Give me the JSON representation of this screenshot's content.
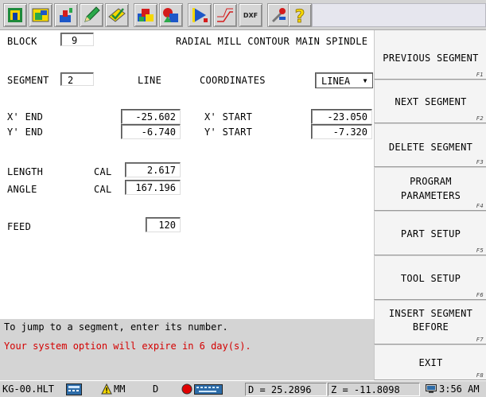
{
  "toolbar": {
    "icons": [
      "home-icon",
      "load-icon",
      "insert-part-icon",
      "pencil-icon",
      "edit-check-icon",
      "solids-icon",
      "shapes-icon",
      "run-icon",
      "path-icon",
      "dxf-icon",
      "tools-icon",
      "help-icon"
    ],
    "dxf_label": "DXF"
  },
  "form": {
    "block_label": "BLOCK",
    "block_value": "9",
    "operation": "RADIAL MILL CONTOUR",
    "spindle": "MAIN SPINDLE",
    "segment_label": "SEGMENT",
    "segment_value": "2",
    "segment_type": "LINE",
    "coordinates_label": "COORDINATES",
    "coordinates_value": "LINEA",
    "x_end_label": "X' END",
    "x_end_value": "-25.602",
    "y_end_label": "Y' END",
    "y_end_value": "-6.740",
    "x_start_label": "X' START",
    "x_start_value": "-23.050",
    "y_start_label": "Y' START",
    "y_start_value": "-7.320",
    "length_label": "LENGTH",
    "length_cal": "CAL",
    "length_value": "2.617",
    "angle_label": "ANGLE",
    "angle_cal": "CAL",
    "angle_value": "167.196",
    "feed_label": "FEED",
    "feed_value": "120"
  },
  "messages": {
    "hint": "To jump to a segment, enter its number.",
    "warning": "Your system option will expire in 6 day(s)."
  },
  "softkeys": [
    {
      "label": "PREVIOUS SEGMENT",
      "key": "F1"
    },
    {
      "label": "NEXT SEGMENT",
      "key": "F2"
    },
    {
      "label": "DELETE SEGMENT",
      "key": "F3"
    },
    {
      "label1": "PROGRAM",
      "label2": "PARAMETERS",
      "key": "F4"
    },
    {
      "label": "PART SETUP",
      "key": "F5"
    },
    {
      "label": "TOOL SETUP",
      "key": "F6"
    },
    {
      "label1": "INSERT SEGMENT",
      "label2": "BEFORE",
      "key": "F7"
    },
    {
      "label": "EXIT",
      "key": "F8"
    }
  ],
  "statusbar": {
    "filename": "KG-00.HLT",
    "units": "MM",
    "mode": "D",
    "diameter": "D = 25.2896",
    "z": "Z = -11.8098",
    "time": "3:56 AM",
    "warning_color": "#d40000",
    "status_on_color": "#e00000"
  }
}
